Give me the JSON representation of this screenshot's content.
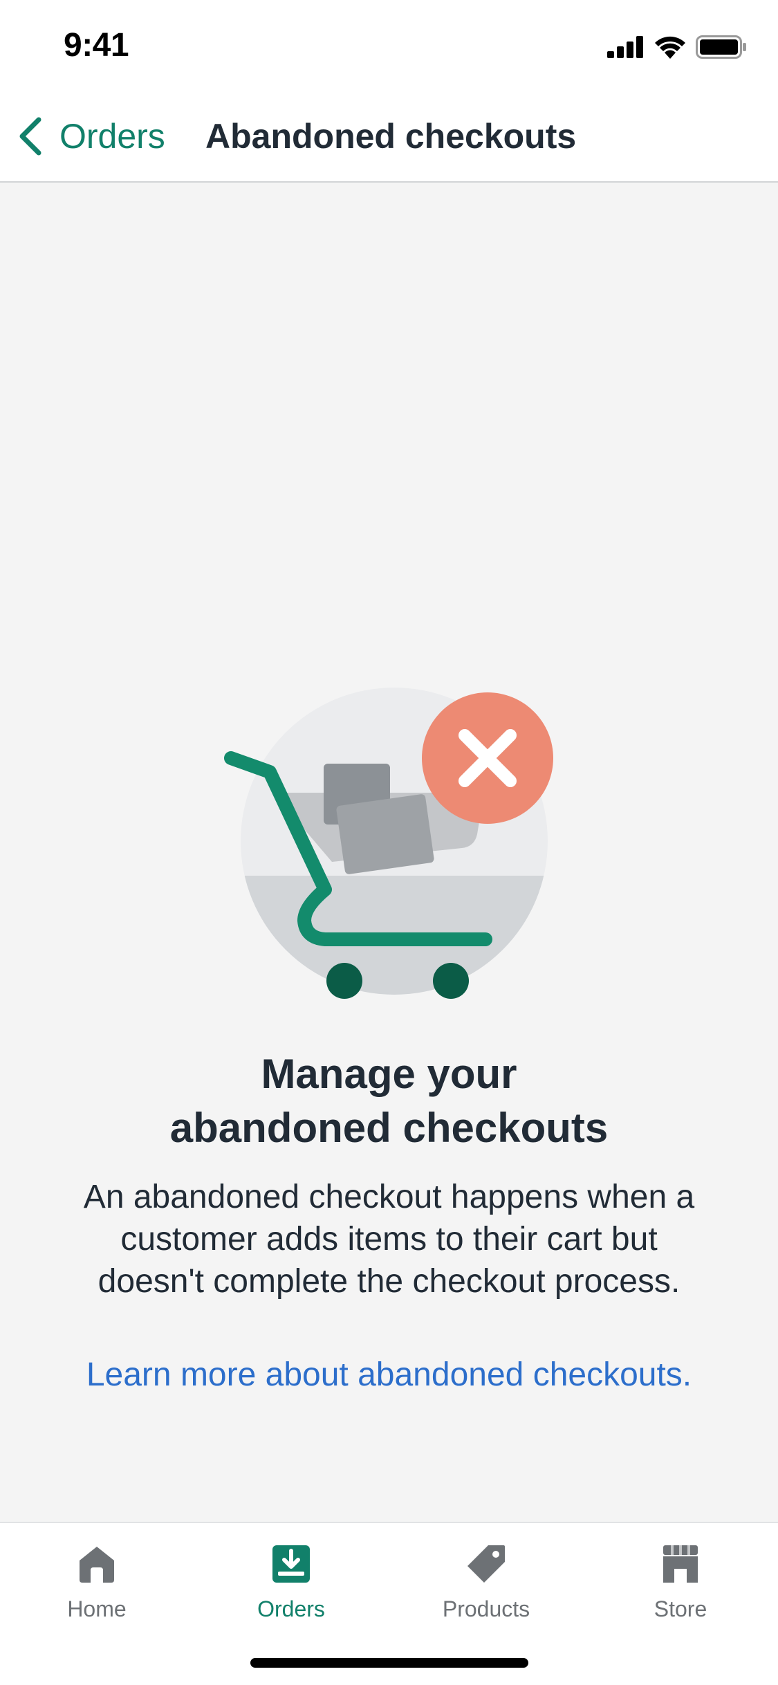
{
  "status_bar": {
    "time": "9:41",
    "icons": [
      "cellular-signal-icon",
      "wifi-icon",
      "battery-icon"
    ]
  },
  "nav": {
    "back_label": "Orders",
    "back_icon": "chevron-left-icon",
    "title": "Abandoned checkouts"
  },
  "empty_state": {
    "illustration": "shopping-cart-with-x-icon",
    "heading_line1": "Manage your",
    "heading_line2": "abandoned checkouts",
    "body_line1": "An abandoned checkout happens when a",
    "body_line2": "customer adds items to their cart but",
    "body_line3": "doesn't complete the checkout process.",
    "link": "Learn more about abandoned checkouts."
  },
  "tab_bar": {
    "tabs": [
      {
        "label": "Home",
        "icon": "home-icon",
        "active": false
      },
      {
        "label": "Orders",
        "icon": "orders-inbox-icon",
        "active": true
      },
      {
        "label": "Products",
        "icon": "tag-icon",
        "active": false
      },
      {
        "label": "Store",
        "icon": "store-icon",
        "active": false
      }
    ]
  },
  "colors": {
    "accent": "#11806a",
    "link": "#2c6ecb",
    "text": "#212b36",
    "inactive_tab": "#6d7175",
    "background": "#f4f4f4",
    "error_badge": "#ed8a73"
  }
}
